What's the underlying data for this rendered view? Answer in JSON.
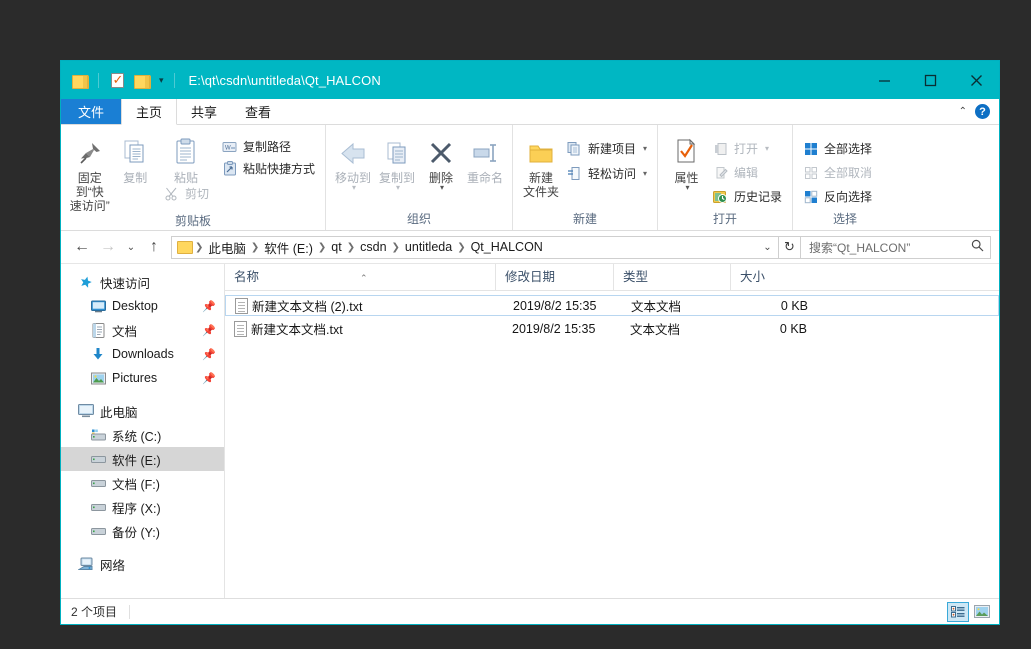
{
  "window": {
    "title_path": "E:\\qt\\csdn\\untitleda\\Qt_HALCON",
    "minimize_label": "—",
    "maximize_label": "□",
    "close_label": "✕"
  },
  "quick_access": {
    "items": [
      {
        "name": "folder-icon",
        "label": ""
      },
      {
        "name": "properties-icon",
        "label": ""
      },
      {
        "name": "new-folder-icon",
        "label": ""
      },
      {
        "name": "customize-dropdown",
        "label": "▾"
      }
    ]
  },
  "tabs": {
    "file": "文件",
    "items": [
      {
        "label": "主页",
        "active": true
      },
      {
        "label": "共享",
        "active": false
      },
      {
        "label": "查看",
        "active": false
      }
    ],
    "collapse_icon": "⌃",
    "help_icon": "?"
  },
  "ribbon": {
    "groups": [
      {
        "label": "剪贴板",
        "big": [
          {
            "label_line1": "固定到“快",
            "label_line2": "速访问”",
            "icon": "pin-icon",
            "disabled": false
          },
          {
            "label_line1": "复制",
            "label_line2": "",
            "icon": "copy-icon",
            "disabled": true
          },
          {
            "label_line1": "粘贴",
            "label_line2": "",
            "icon": "paste-icon",
            "disabled": true
          }
        ],
        "small": [
          {
            "label": "复制路径",
            "icon": "copy-path-icon",
            "disabled": false
          },
          {
            "label": "粘贴快捷方式",
            "icon": "paste-shortcut-icon",
            "disabled": false
          }
        ],
        "cut": {
          "label": "剪切",
          "icon": "scissors-icon",
          "disabled": true
        }
      },
      {
        "label": "组织",
        "big": [
          {
            "label_line1": "移动到",
            "label_line2": "",
            "icon": "move-to-icon",
            "disabled": true,
            "dropdown": true
          },
          {
            "label_line1": "复制到",
            "label_line2": "",
            "icon": "copy-to-icon",
            "disabled": true,
            "dropdown": true
          },
          {
            "label_line1": "删除",
            "label_line2": "",
            "icon": "delete-icon",
            "disabled": false,
            "dropdown": true
          },
          {
            "label_line1": "重命名",
            "label_line2": "",
            "icon": "rename-icon",
            "disabled": true
          }
        ]
      },
      {
        "label": "新建",
        "big": [
          {
            "label_line1": "新建",
            "label_line2": "文件夹",
            "icon": "new-folder-icon",
            "disabled": false
          }
        ],
        "small": [
          {
            "label": "新建项目",
            "icon": "new-item-icon",
            "disabled": false,
            "dropdown": true
          },
          {
            "label": "轻松访问",
            "icon": "easy-access-icon",
            "disabled": false,
            "dropdown": true
          }
        ]
      },
      {
        "label": "打开",
        "big": [
          {
            "label_line1": "属性",
            "label_line2": "",
            "icon": "properties-icon",
            "disabled": false,
            "dropdown": true
          }
        ],
        "small": [
          {
            "label": "打开",
            "icon": "open-icon",
            "disabled": true,
            "dropdown": true
          },
          {
            "label": "编辑",
            "icon": "edit-icon",
            "disabled": true
          },
          {
            "label": "历史记录",
            "icon": "history-icon",
            "disabled": false
          }
        ]
      },
      {
        "label": "选择",
        "small": [
          {
            "label": "全部选择",
            "icon": "select-all-icon",
            "disabled": false
          },
          {
            "label": "全部取消",
            "icon": "select-none-icon",
            "disabled": true
          },
          {
            "label": "反向选择",
            "icon": "invert-selection-icon",
            "disabled": false
          }
        ]
      }
    ]
  },
  "address": {
    "back_icon": "←",
    "forward_icon": "→",
    "recent_icon": "⌄",
    "up_icon": "↑",
    "crumbs": [
      "此电脑",
      "软件 (E:)",
      "qt",
      "csdn",
      "untitleda",
      "Qt_HALCON"
    ],
    "separator": "❯",
    "dropdown_icon": "⌄",
    "refresh_icon": "↻"
  },
  "search": {
    "placeholder": "搜索“Qt_HALCON”",
    "icon": "search-icon"
  },
  "sidebar": {
    "groups": [
      {
        "header": {
          "label": "快速访问",
          "icon": "star-icon"
        },
        "items": [
          {
            "label": "Desktop",
            "icon": "desktop-icon",
            "pinned": true,
            "selected": false
          },
          {
            "label": "文档",
            "icon": "documents-icon",
            "pinned": true,
            "selected": false
          },
          {
            "label": "Downloads",
            "icon": "downloads-icon",
            "pinned": true,
            "selected": false
          },
          {
            "label": "Pictures",
            "icon": "pictures-icon",
            "pinned": true,
            "selected": false
          }
        ]
      },
      {
        "header": {
          "label": "此电脑",
          "icon": "this-pc-icon"
        },
        "items": [
          {
            "label": "系统 (C:)",
            "icon": "system-drive-icon",
            "pinned": false,
            "selected": false
          },
          {
            "label": "软件 (E:)",
            "icon": "drive-icon",
            "pinned": false,
            "selected": true
          },
          {
            "label": "文档 (F:)",
            "icon": "drive-icon",
            "pinned": false,
            "selected": false
          },
          {
            "label": "程序 (X:)",
            "icon": "drive-icon",
            "pinned": false,
            "selected": false
          },
          {
            "label": "备份 (Y:)",
            "icon": "drive-icon",
            "pinned": false,
            "selected": false
          }
        ]
      },
      {
        "header": {
          "label": "网络",
          "icon": "network-icon"
        },
        "items": []
      }
    ]
  },
  "filelist": {
    "columns": [
      {
        "label": "名称",
        "sorted": true,
        "sort_icon": "⌃"
      },
      {
        "label": "修改日期",
        "sorted": false
      },
      {
        "label": "类型",
        "sorted": false
      },
      {
        "label": "大小",
        "sorted": false
      }
    ],
    "rows": [
      {
        "name": "新建文本文档 (2).txt",
        "date": "2019/8/2 15:35",
        "type": "文本文档",
        "size": "0 KB",
        "icon": "text-file-icon",
        "focused": true
      },
      {
        "name": "新建文本文档.txt",
        "date": "2019/8/2 15:35",
        "type": "文本文档",
        "size": "0 KB",
        "icon": "text-file-icon",
        "focused": false
      }
    ]
  },
  "status": {
    "item_count": "2 个项目",
    "views": [
      {
        "name": "details-view-button",
        "active": true
      },
      {
        "name": "large-icons-view-button",
        "active": false
      }
    ]
  },
  "colors": {
    "titlebar": "#00b7c3",
    "file_tab": "#1a7fd4",
    "selection": "#d6d6d6",
    "focus_border": "#b8d6f0",
    "column_header_text": "#3b5069",
    "view_active": "#cde7f5"
  }
}
